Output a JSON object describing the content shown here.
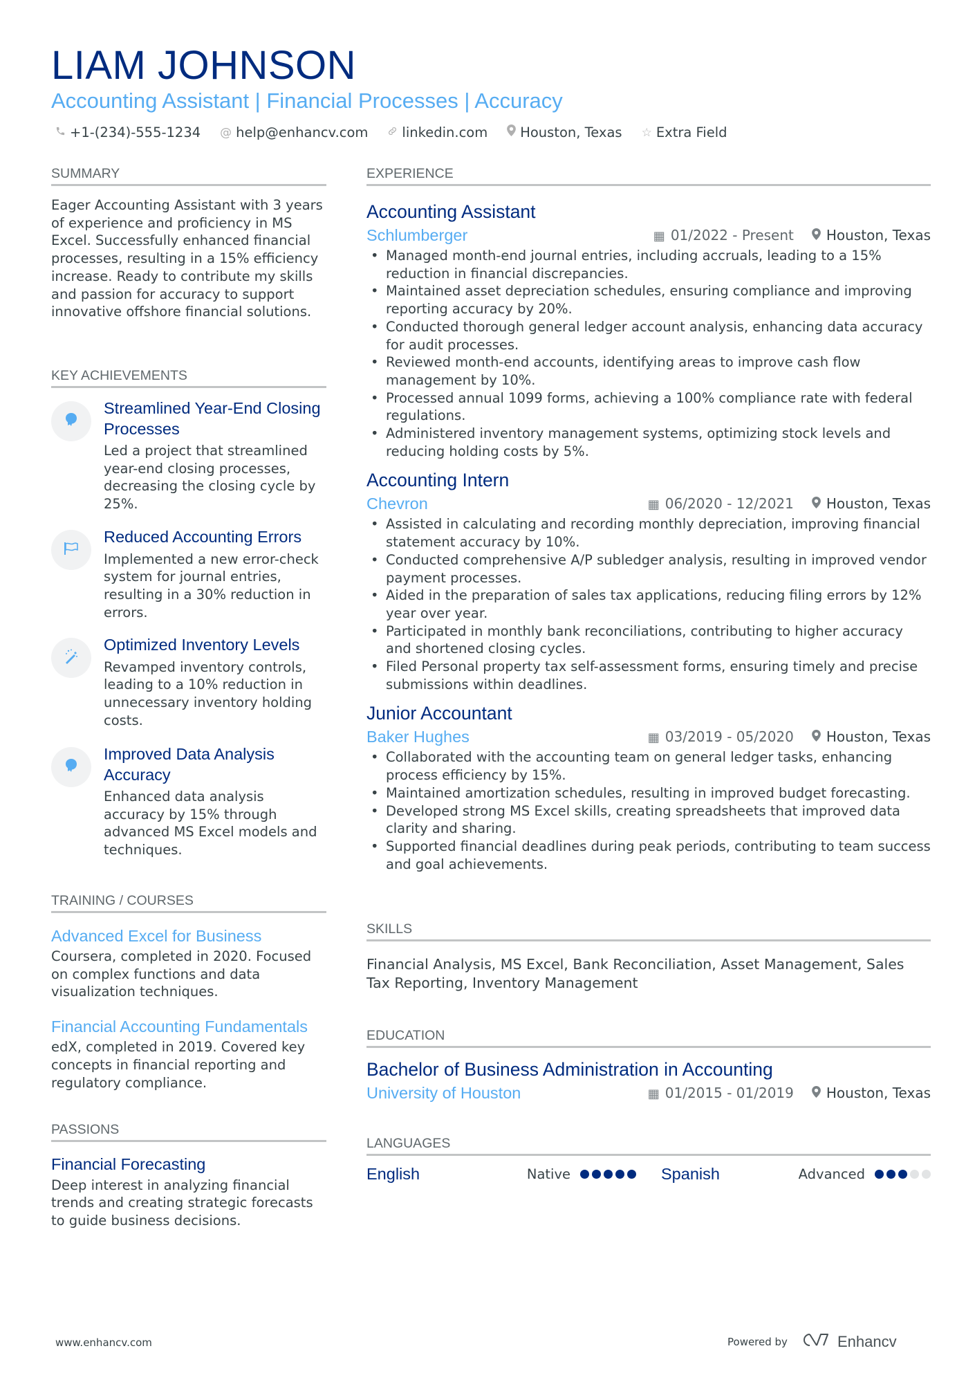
{
  "header": {
    "name": "LIAM JOHNSON",
    "subtitle": "Accounting Assistant | Financial Processes | Accuracy",
    "contacts": [
      {
        "icon": "phone-icon",
        "glyph": "✆",
        "text": "+1-(234)-555-1234"
      },
      {
        "icon": "at-icon",
        "glyph": "@",
        "text": "help@enhancv.com"
      },
      {
        "icon": "link-icon",
        "glyph": "∞",
        "text": "linkedin.com"
      },
      {
        "icon": "location-icon",
        "glyph": "⌖",
        "text": "Houston, Texas"
      },
      {
        "icon": "star-icon",
        "glyph": "☆",
        "text": "Extra Field"
      }
    ]
  },
  "summary": {
    "title": "SUMMARY",
    "text": "Eager Accounting Assistant with 3 years of experience and proficiency in MS Excel. Successfully enhanced financial processes, resulting in a 15% efficiency increase. Ready to contribute my skills and passion for accuracy to support innovative offshore financial solutions."
  },
  "achievements": {
    "title": "KEY ACHIEVEMENTS",
    "items": [
      {
        "icon": "brain-head-icon",
        "title": "Streamlined Year-End Closing Processes",
        "text": "Led a project that streamlined year-end closing processes, decreasing the closing cycle by 25%."
      },
      {
        "icon": "flag-icon",
        "title": "Reduced Accounting Errors",
        "text": "Implemented a new error-check system for journal entries, resulting in a 30% reduction in errors."
      },
      {
        "icon": "magic-wand-icon",
        "title": "Optimized Inventory Levels",
        "text": "Revamped inventory controls, leading to a 10% reduction in unnecessary inventory holding costs."
      },
      {
        "icon": "brain-head-icon",
        "title": "Improved Data Analysis Accuracy",
        "text": "Enhanced data analysis accuracy by 15% through advanced MS Excel models and techniques."
      }
    ]
  },
  "training": {
    "title": "TRAINING / COURSES",
    "items": [
      {
        "title": "Advanced Excel for Business",
        "text": "Coursera, completed in 2020. Focused on complex functions and data visualization techniques."
      },
      {
        "title": "Financial Accounting Fundamentals",
        "text": "edX, completed in 2019. Covered key concepts in financial reporting and regulatory compliance."
      }
    ]
  },
  "passions": {
    "title": "PASSIONS",
    "items": [
      {
        "title": "Financial Forecasting",
        "text": "Deep interest in analyzing financial trends and creating strategic forecasts to guide business decisions."
      }
    ]
  },
  "experience": {
    "title": "EXPERIENCE",
    "jobs": [
      {
        "title": "Accounting Assistant",
        "company": "Schlumberger",
        "dates": "01/2022 - Present",
        "location": "Houston, Texas",
        "bullets": [
          "Managed month-end journal entries, including accruals, leading to a 15% reduction in financial discrepancies.",
          "Maintained asset depreciation schedules, ensuring compliance and improving reporting accuracy by 20%.",
          "Conducted thorough general ledger account analysis, enhancing data accuracy for audit processes.",
          "Reviewed month-end accounts, identifying areas to improve cash flow management by 10%.",
          "Processed annual 1099 forms, achieving a 100% compliance rate with federal regulations.",
          "Administered inventory management systems, optimizing stock levels and reducing holding costs by 5%."
        ]
      },
      {
        "title": "Accounting Intern",
        "company": "Chevron",
        "dates": "06/2020 - 12/2021",
        "location": "Houston, Texas",
        "bullets": [
          "Assisted in calculating and recording monthly depreciation, improving financial statement accuracy by 10%.",
          "Conducted comprehensive A/P subledger analysis, resulting in improved vendor payment processes.",
          "Aided in the preparation of sales tax applications, reducing filing errors by 12% year over year.",
          "Participated in monthly bank reconciliations, contributing to higher accuracy and shortened closing cycles.",
          "Filed Personal property tax self-assessment forms, ensuring timely and precise submissions within deadlines."
        ]
      },
      {
        "title": "Junior Accountant",
        "company": "Baker Hughes",
        "dates": "03/2019 - 05/2020",
        "location": "Houston, Texas",
        "bullets": [
          "Collaborated with the accounting team on general ledger tasks, enhancing process efficiency by 15%.",
          "Maintained amortization schedules, resulting in improved budget forecasting.",
          "Developed strong MS Excel skills, creating spreadsheets that improved data clarity and sharing.",
          "Supported financial deadlines during peak periods, contributing to team success and goal achievements."
        ]
      }
    ]
  },
  "skills": {
    "title": "SKILLS",
    "text": "Financial Analysis, MS Excel, Bank Reconciliation, Asset Management, Sales Tax Reporting, Inventory Management"
  },
  "education": {
    "title": "EDUCATION",
    "items": [
      {
        "degree": "Bachelor of Business Administration in Accounting",
        "school": "University of Houston",
        "dates": "01/2015 - 01/2019",
        "location": "Houston, Texas"
      }
    ]
  },
  "languages": {
    "title": "LANGUAGES",
    "items": [
      {
        "name": "English",
        "level": "Native",
        "rating": 5,
        "max": 5
      },
      {
        "name": "Spanish",
        "level": "Advanced",
        "rating": 3,
        "max": 5
      }
    ]
  },
  "footer": {
    "website": "www.enhancv.com",
    "powered_by": "Powered by",
    "brand": "Enhancv"
  },
  "colors": {
    "primary": "#002b7f",
    "accent": "#56acf2",
    "text": "#384347",
    "rule": "#c2c4c5"
  }
}
